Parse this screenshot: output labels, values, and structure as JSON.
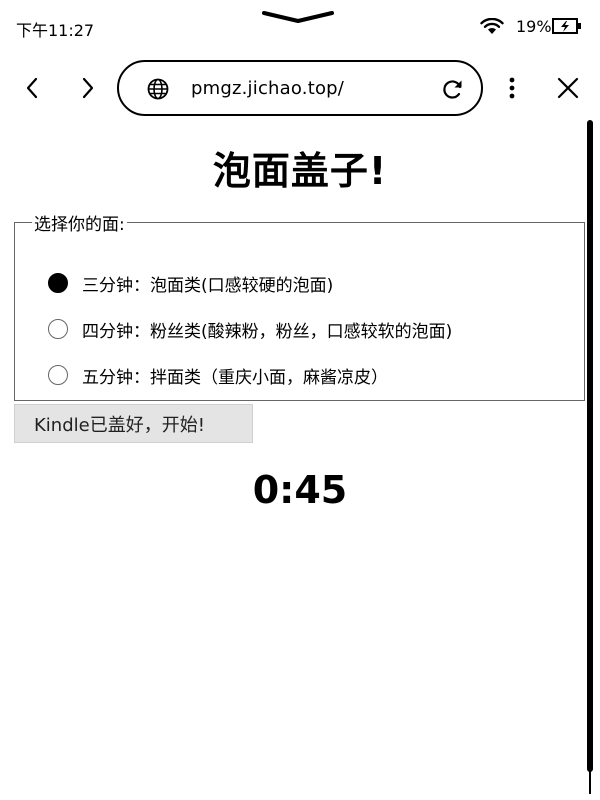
{
  "status_bar": {
    "time": "下午11:27",
    "battery_percent": "19%"
  },
  "browser": {
    "url": "pmgz.jichao.top/"
  },
  "page": {
    "title": "泡面盖子!",
    "fieldset_legend": "选择你的面:",
    "options": [
      {
        "label": "三分钟：泡面类(口感较硬的泡面)",
        "selected": true
      },
      {
        "label": "四分钟：粉丝类(酸辣粉，粉丝，口感较软的泡面)",
        "selected": false
      },
      {
        "label": "五分钟：拌面类（重庆小面，麻酱凉皮）",
        "selected": false
      }
    ],
    "start_button_label": "Kindle已盖好，开始!",
    "timer": "0:45"
  }
}
